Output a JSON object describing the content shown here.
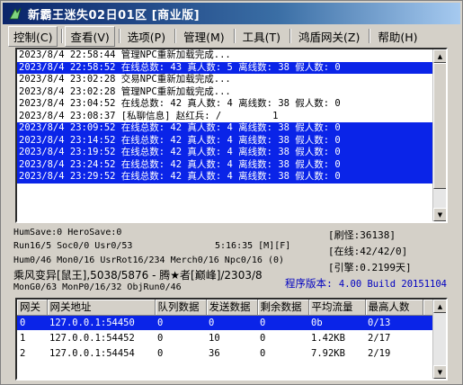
{
  "window": {
    "title": "新霸王迷失02日01区 [商业版]"
  },
  "menu": [
    {
      "label": "控制(C)"
    },
    {
      "label": "查看(V)"
    },
    {
      "label": "选项(P)"
    },
    {
      "label": "管理(M)"
    },
    {
      "label": "工具(T)"
    },
    {
      "label": "鸿盾网关(Z)"
    },
    {
      "label": "帮助(H)"
    }
  ],
  "log": [
    {
      "text": "2023/8/4 22:58:44 管理NPC重新加载完成...",
      "highlight": false
    },
    {
      "text": "2023/8/4 22:58:52 在线总数: 43 真人数: 5 离线数: 38 假人数: 0",
      "highlight": true
    },
    {
      "text": "2023/8/4 23:02:28 交易NPC重新加载完成...",
      "highlight": false
    },
    {
      "text": "2023/8/4 23:02:28 管理NPC重新加载完成...",
      "highlight": false
    },
    {
      "text": "2023/8/4 23:04:52 在线总数: 42 真人数: 4 离线数: 38 假人数: 0",
      "highlight": false
    },
    {
      "text": "2023/8/4 23:08:37 [私聊信息] 赵红兵: /         1",
      "highlight": false
    },
    {
      "text": "2023/8/4 23:09:52 在线总数: 42 真人数: 4 离线数: 38 假人数: 0",
      "highlight": true
    },
    {
      "text": "2023/8/4 23:14:52 在线总数: 42 真人数: 4 离线数: 38 假人数: 0",
      "highlight": true
    },
    {
      "text": "2023/8/4 23:19:52 在线总数: 42 真人数: 4 离线数: 38 假人数: 0",
      "highlight": true
    },
    {
      "text": "2023/8/4 23:24:52 在线总数: 42 真人数: 4 离线数: 38 假人数: 0",
      "highlight": true
    },
    {
      "text": "2023/8/4 23:29:52 在线总数: 42 真人数: 4 离线数: 38 假人数: 0",
      "highlight": true
    }
  ],
  "status": {
    "line1": "HumSave:0 HeroSave:0",
    "line2": "Run16/5 Soc0/0 Usr0/53",
    "time": "5:16:35 [M][F]",
    "line3": "Hum0/46 Mon0/16 UsrRot16/234 Merch0/16 Npc0/16 (0)",
    "line4": "乘风变异[鼠王],5038/5876 - 腾★者[巅峰]/2303/8",
    "line5": "MonG0/63 MonP0/16/32 ObjRun0/46",
    "refresh": "[刷怪:36138]",
    "online": "[在线:42/42/0]",
    "ref": "[引擎:0.2199天]",
    "version_label": "程序版本:",
    "version_value": "4.00 Build 20151104"
  },
  "table": {
    "headers": [
      "网关",
      "网关地址",
      "队列数据",
      "发送数据",
      "剩余数据",
      "平均流量",
      "最高人数"
    ],
    "rows": [
      [
        "0",
        "127.0.0.1:54450",
        "0",
        "0",
        "0",
        "0b",
        "0/13"
      ],
      [
        "1",
        "127.0.0.1:54452",
        "0",
        "10",
        "0",
        "1.42KB",
        "2/17"
      ],
      [
        "2",
        "127.0.0.1:54454",
        "0",
        "36",
        "0",
        "7.92KB",
        "2/19"
      ]
    ],
    "selected_row": 0
  }
}
